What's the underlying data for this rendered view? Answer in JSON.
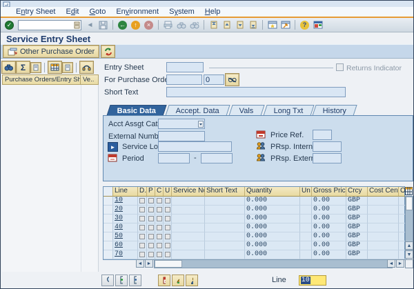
{
  "menu": {
    "items": [
      {
        "label": "Entry Sheet",
        "mnemonic": 1
      },
      {
        "label": "Edit",
        "mnemonic": 1
      },
      {
        "label": "Goto",
        "mnemonic": 0
      },
      {
        "label": "Environment",
        "mnemonic": 2
      },
      {
        "label": "System",
        "mnemonic": 1
      },
      {
        "label": "Help",
        "mnemonic": 0
      }
    ]
  },
  "toolbar": {
    "command_value": ""
  },
  "page": {
    "title": "Service Entry Sheet"
  },
  "app_toolbar": {
    "other_po_label": "Other Purchase Order"
  },
  "left_panel": {
    "header_col1": "Purchase Orders/Entry Sheets",
    "header_col2": "Ve.."
  },
  "form": {
    "entry_sheet_label": "Entry Sheet",
    "entry_sheet_value": "",
    "returns_indicator_label": "Returns Indicator",
    "for_po_label": "For Purchase Order",
    "for_po_value": "",
    "po_item_value": "0",
    "short_text_label": "Short Text",
    "short_text_value": ""
  },
  "tabs": [
    {
      "label": "Basic Data",
      "active": true
    },
    {
      "label": "Accept. Data",
      "active": false
    },
    {
      "label": "Vals",
      "active": false
    },
    {
      "label": "Long Txt",
      "active": false
    },
    {
      "label": "History",
      "active": false
    }
  ],
  "basic_data": {
    "acct_assgt_label": "Acct Assgt Cat.",
    "acct_assgt_value": "",
    "external_number_label": "External Number",
    "external_number_value": "",
    "service_loc_label": "Service Loc.",
    "service_loc_value": "",
    "period_label": "Period",
    "period_from": "",
    "period_separator": "-",
    "period_to": "",
    "price_ref_label": "Price Ref.",
    "price_ref_value": "",
    "prsp_intern_label": "PRsp. Intern.",
    "prsp_intern_value": "",
    "prsp_extern_label": "PRsp. Extern.",
    "prsp_extern_value": ""
  },
  "table": {
    "headers": [
      "Line",
      "D..",
      "P",
      "C",
      "U",
      "Service No.",
      "Short Text",
      "Quantity",
      "Un",
      "Gross Price",
      "Crcy",
      "Cost Center",
      "Orde"
    ],
    "rows": [
      {
        "line": "10",
        "service_no": "",
        "short_text": "",
        "quantity": "0.000",
        "un": "",
        "gross_price": "0.00",
        "crcy": "GBP",
        "cost_center": "",
        "orde": ""
      },
      {
        "line": "20",
        "service_no": "",
        "short_text": "",
        "quantity": "0.000",
        "un": "",
        "gross_price": "0.00",
        "crcy": "GBP",
        "cost_center": "",
        "orde": ""
      },
      {
        "line": "30",
        "service_no": "",
        "short_text": "",
        "quantity": "0.000",
        "un": "",
        "gross_price": "0.00",
        "crcy": "GBP",
        "cost_center": "",
        "orde": ""
      },
      {
        "line": "40",
        "service_no": "",
        "short_text": "",
        "quantity": "0.000",
        "un": "",
        "gross_price": "0.00",
        "crcy": "GBP",
        "cost_center": "",
        "orde": ""
      },
      {
        "line": "50",
        "service_no": "",
        "short_text": "",
        "quantity": "0.000",
        "un": "",
        "gross_price": "0.00",
        "crcy": "GBP",
        "cost_center": "",
        "orde": ""
      },
      {
        "line": "60",
        "service_no": "",
        "short_text": "",
        "quantity": "0.000",
        "un": "",
        "gross_price": "0.00",
        "crcy": "GBP",
        "cost_center": "",
        "orde": ""
      },
      {
        "line": "70",
        "service_no": "",
        "short_text": "",
        "quantity": "0.000",
        "un": "",
        "gross_price": "0.00",
        "crcy": "GBP",
        "cost_center": "",
        "orde": ""
      }
    ]
  },
  "footer": {
    "line_label": "Line",
    "line_value": "10"
  },
  "colors": {
    "accent_orange": "#e79a33",
    "tab_active_blue": "#31639c",
    "header_tan": "#efe1a7",
    "input_blue": "#d9e6f4",
    "title_navy": "#1c3a6b",
    "scroll_track": "#a9bed0"
  },
  "glyphs": {
    "check": "✓",
    "left_tri": "◄",
    "right_tri": "►",
    "up_tri": "▲",
    "down_tri": "▼",
    "sum": "Σ",
    "help": "?",
    "dash": "-",
    "play": "►"
  }
}
